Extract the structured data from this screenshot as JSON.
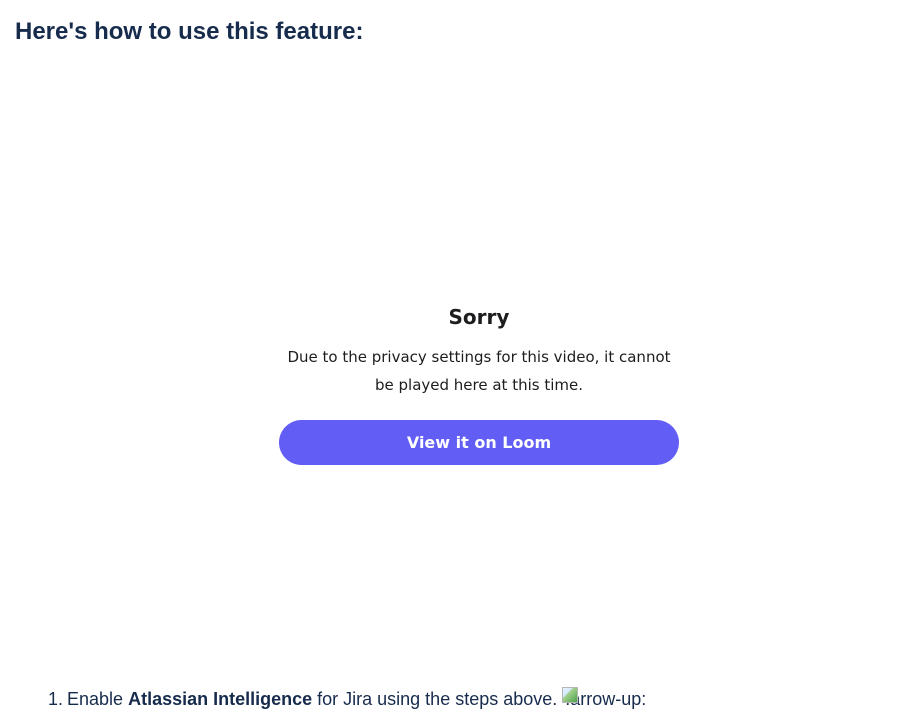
{
  "heading": "Here's how to use this feature:",
  "video": {
    "title": "Sorry",
    "message": "Due to the privacy settings for this video, it cannot be played here at this time.",
    "button_label": "View it on Loom",
    "button_color": "#625df5"
  },
  "steps": [
    {
      "number": "1.",
      "prefix": "Enable ",
      "bold": "Atlassian Intelligence",
      "suffix": " for Jira using the steps above. ",
      "image_alt": ":arrow-up:"
    }
  ]
}
